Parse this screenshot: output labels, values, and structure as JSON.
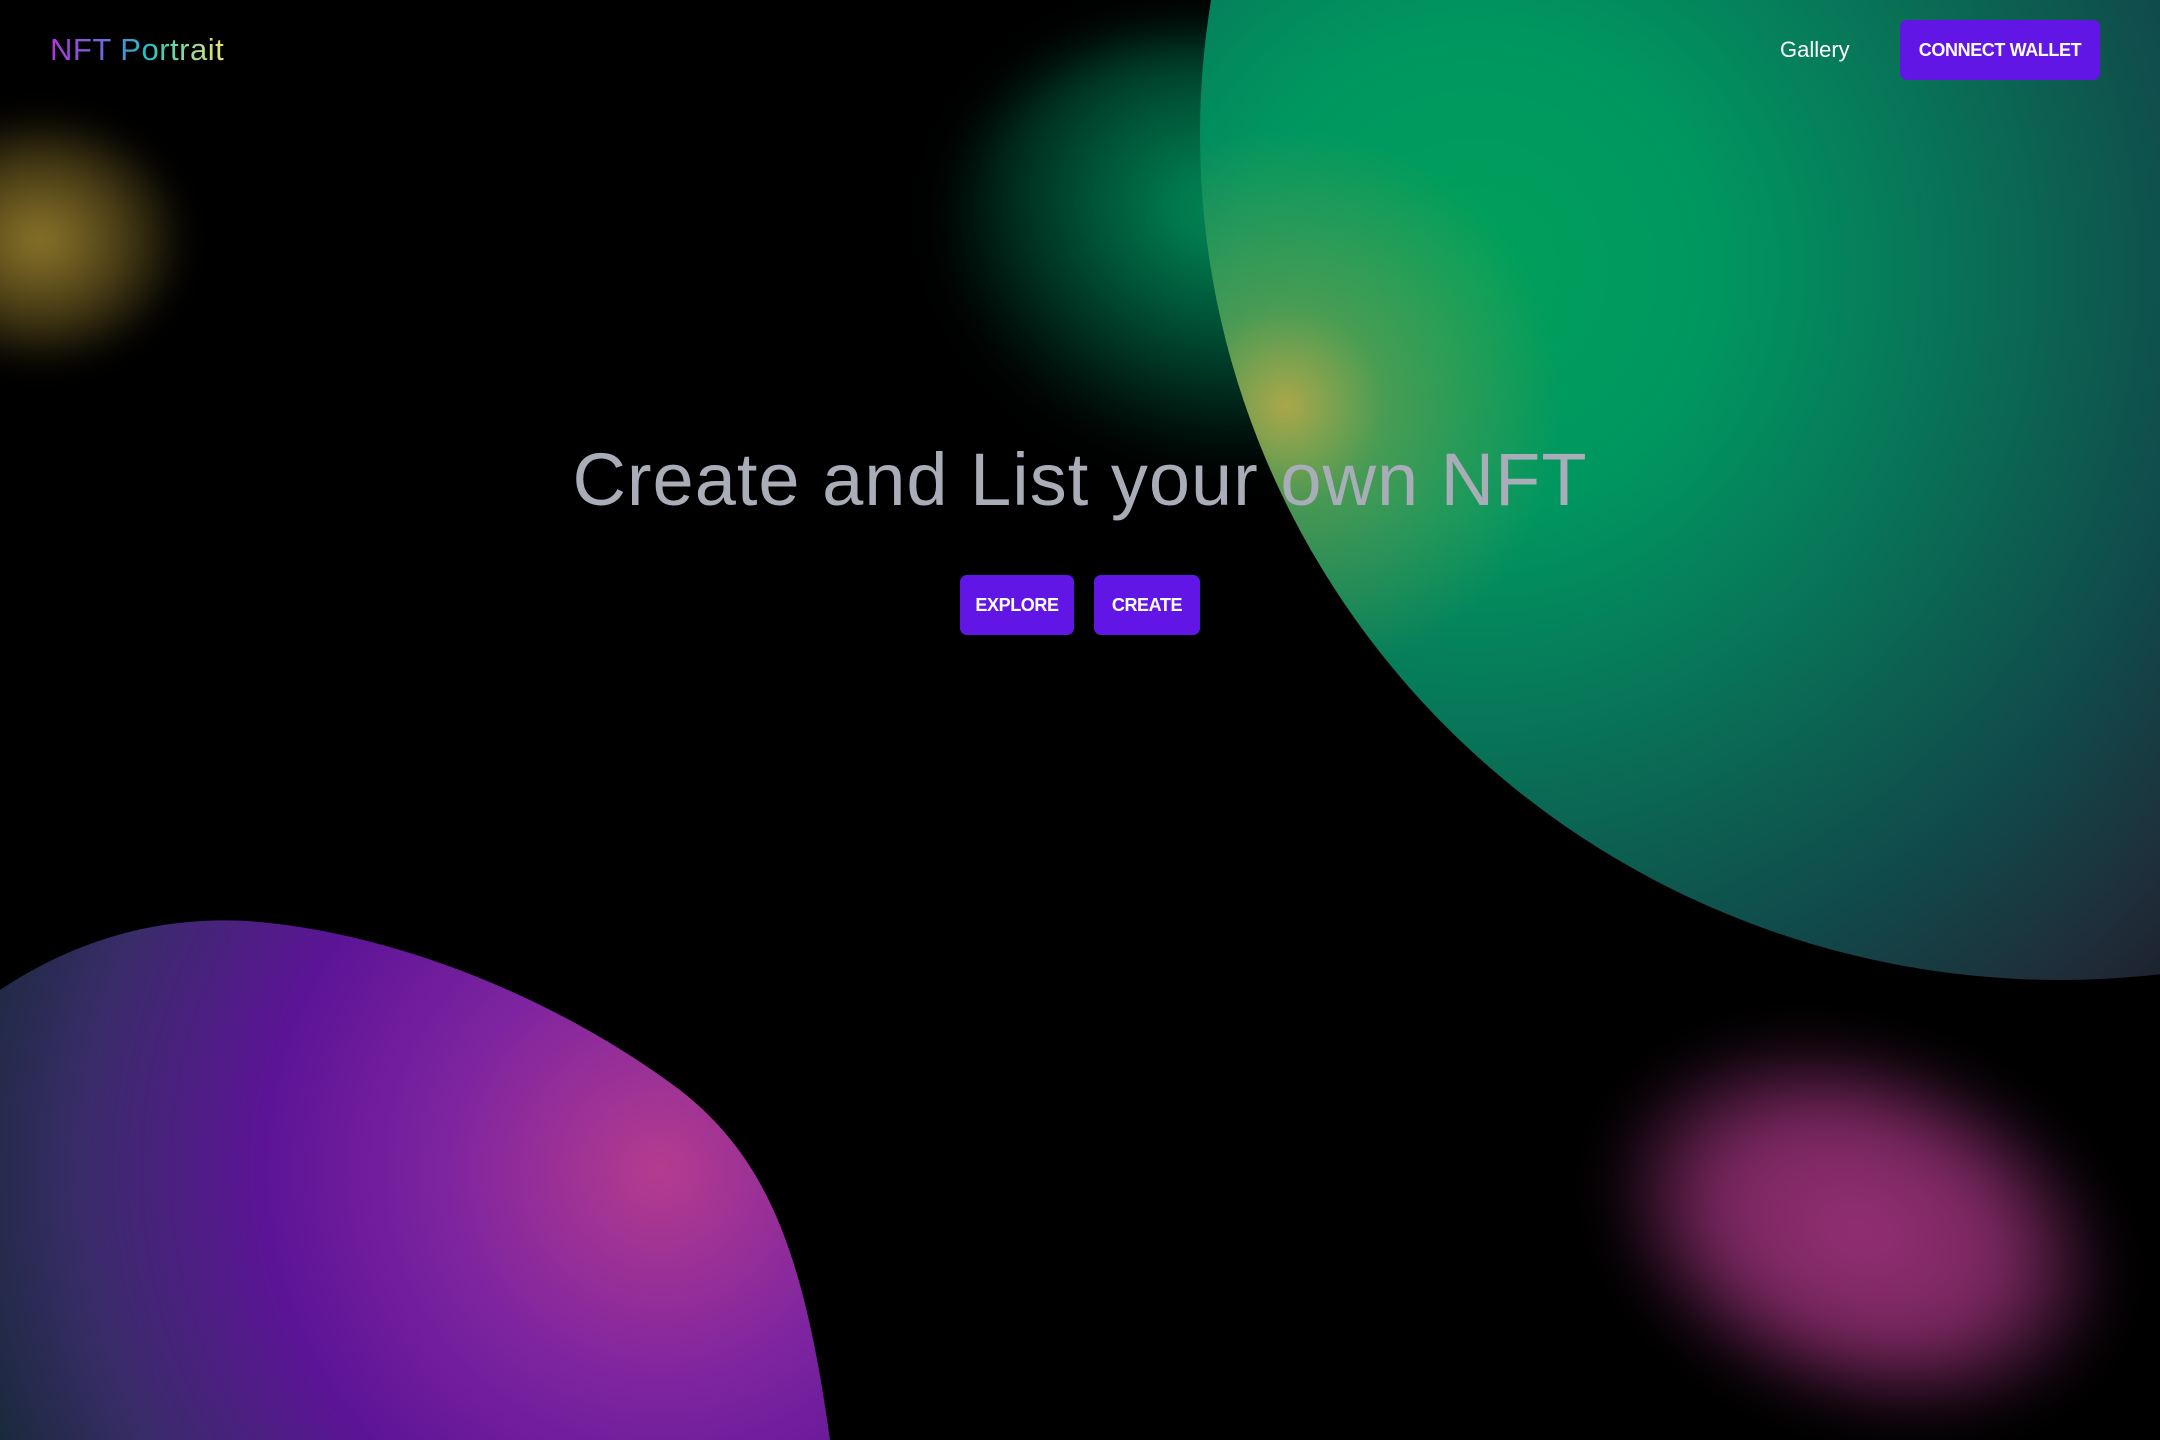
{
  "header": {
    "logo_text": "NFT Portrait",
    "nav": {
      "gallery_label": "Gallery"
    },
    "connect_wallet_label": "CONNECT WALLET"
  },
  "hero": {
    "title": "Create and List your own NFT",
    "explore_label": "EXPLORE",
    "create_label": "CREATE"
  },
  "colors": {
    "background": "#000000",
    "button_accent": "#6216e6",
    "hero_text": "#a9adb8",
    "logo_gradient": [
      "#b334d8",
      "#20c2c9",
      "#e7e07a"
    ]
  }
}
